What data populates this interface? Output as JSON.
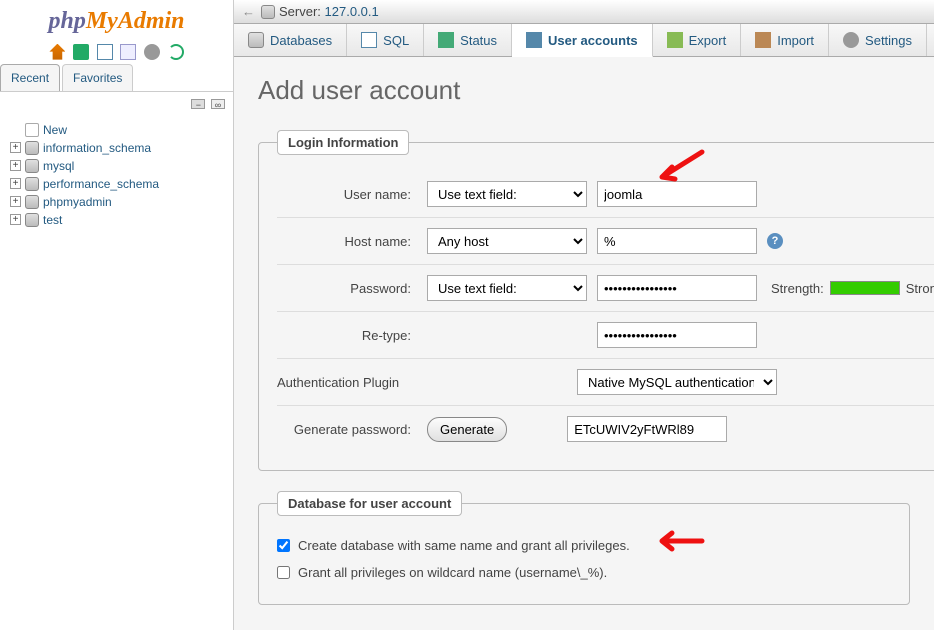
{
  "sidebar": {
    "logo": {
      "php": "php",
      "my": "My",
      "admin": "Admin"
    },
    "nav": {
      "recent": "Recent",
      "favorites": "Favorites"
    },
    "tree": {
      "new": "New",
      "items": [
        {
          "label": "information_schema"
        },
        {
          "label": "mysql"
        },
        {
          "label": "performance_schema"
        },
        {
          "label": "phpmyadmin"
        },
        {
          "label": "test"
        }
      ]
    }
  },
  "topbar": {
    "server_label": "Server:",
    "server_value": "127.0.0.1"
  },
  "tabs": {
    "databases": "Databases",
    "sql": "SQL",
    "status": "Status",
    "user_accounts": "User accounts",
    "export": "Export",
    "import": "Import",
    "settings": "Settings"
  },
  "page": {
    "title": "Add user account",
    "login_legend": "Login Information",
    "labels": {
      "username": "User name:",
      "hostname": "Host name:",
      "password": "Password:",
      "retype": "Re-type:",
      "auth_plugin": "Authentication Plugin",
      "generate": "Generate password:"
    },
    "selects": {
      "username_mode": "Use text field:",
      "host_mode": "Any host",
      "password_mode": "Use text field:",
      "auth_plugin": "Native MySQL authentication"
    },
    "values": {
      "username": "joomla",
      "host": "%",
      "password": "••••••••••••••••",
      "retype": "••••••••••••••••",
      "generated": "ETcUWIV2yFtWRl89"
    },
    "strength_label": "Strength:",
    "strength_value": "Strong",
    "generate_button": "Generate",
    "db_legend": "Database for user account",
    "checkbox1": "Create database with same name and grant all privileges.",
    "checkbox2": "Grant all privileges on wildcard name (username\\_%)."
  }
}
